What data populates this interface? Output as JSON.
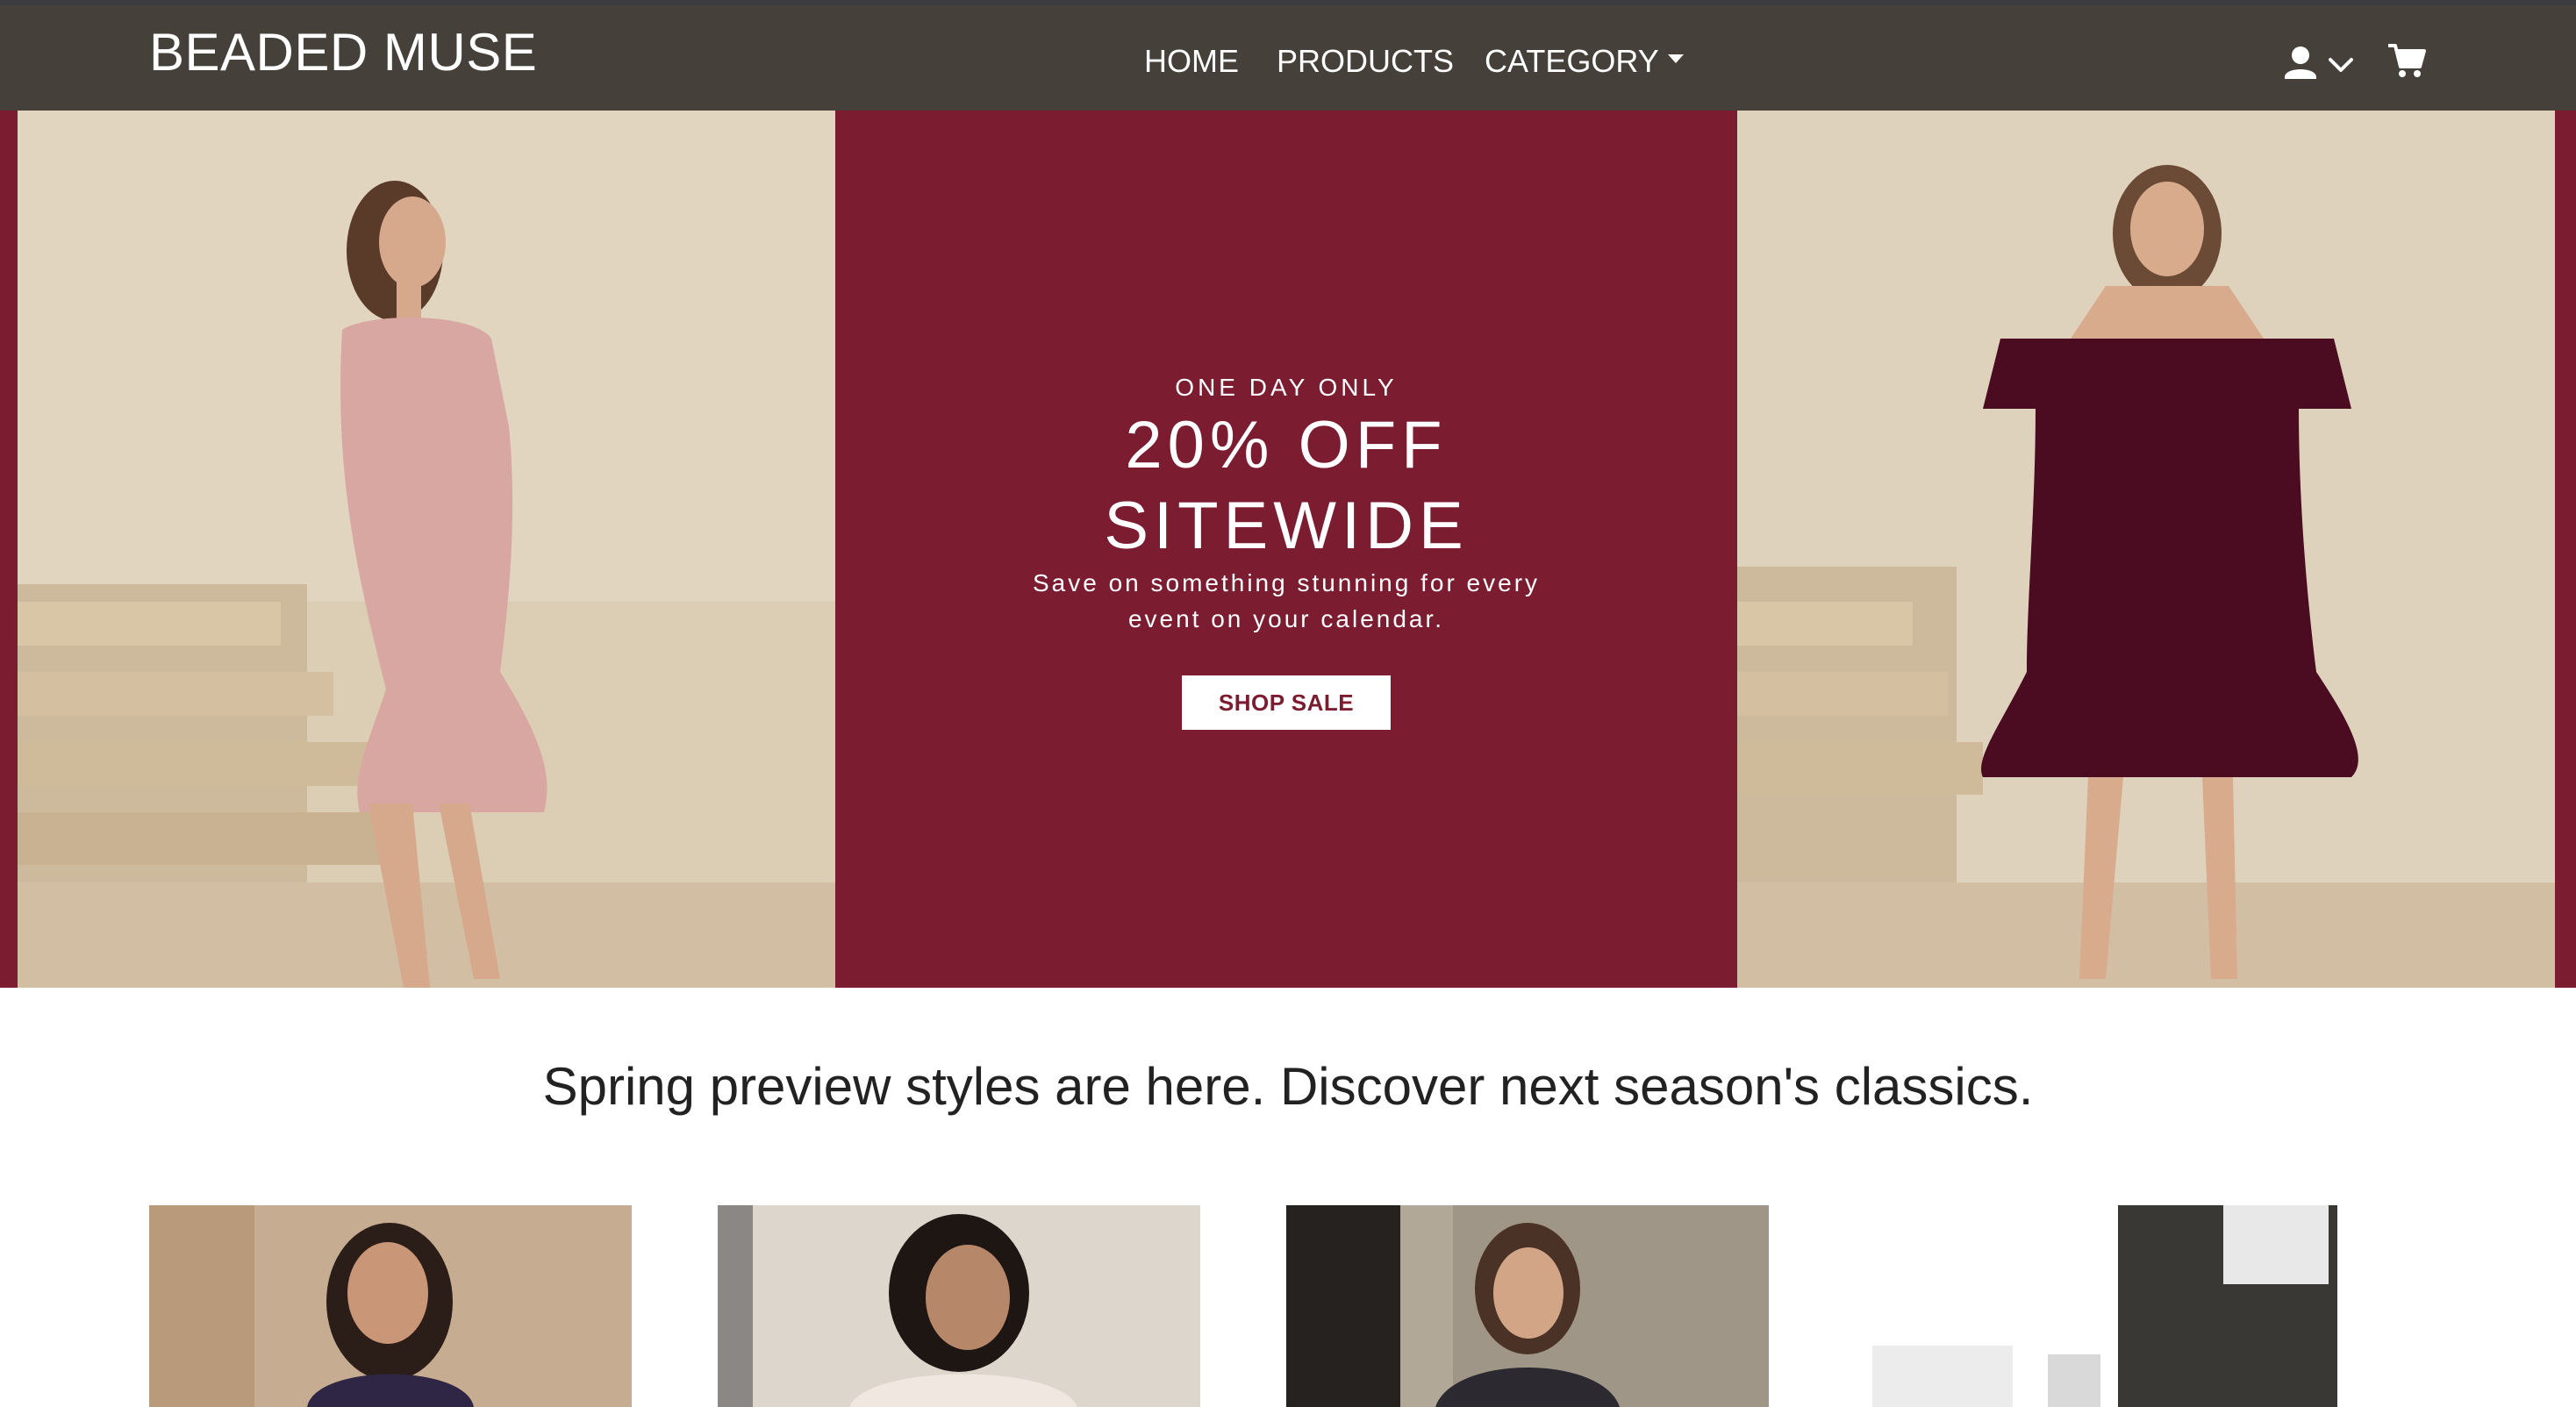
{
  "brand": {
    "name": "BEADED MUSE"
  },
  "nav": {
    "home": "HOME",
    "products": "PRODUCTS",
    "category": "CATEGORY"
  },
  "icons": {
    "user": "user-icon",
    "chevron": "chevron-down-icon",
    "cart": "cart-icon"
  },
  "hero": {
    "eyebrow": "ONE DAY ONLY",
    "headline_line1": "20% OFF",
    "headline_line2": "SITEWIDE",
    "subtext": "Save on something stunning for every event on your calendar.",
    "cta": "SHOP SALE"
  },
  "section": {
    "tagline": "Spring preview styles are here. Discover next season's classics."
  },
  "colors": {
    "navbar": "#46403a",
    "accent": "#7c1c31",
    "text": "#222222"
  }
}
